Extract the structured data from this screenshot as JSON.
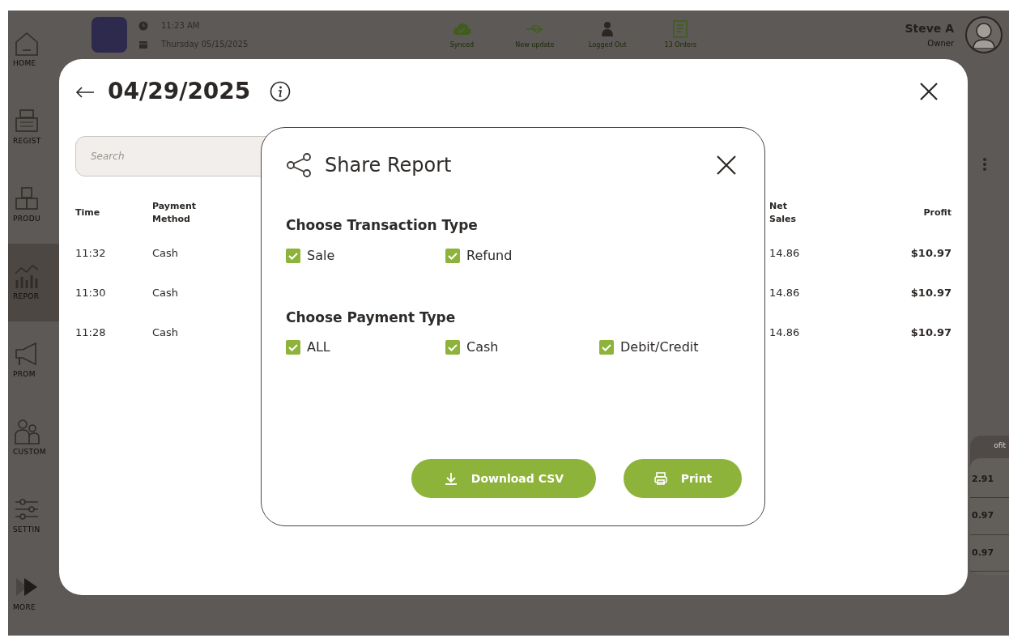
{
  "sidebar": {
    "items": [
      {
        "kind": "home",
        "label": "HOME",
        "selected": false
      },
      {
        "kind": "register",
        "label": "REGIST",
        "selected": false
      },
      {
        "kind": "products",
        "label": "PRODU",
        "selected": false
      },
      {
        "kind": "reports",
        "label": "REPOR",
        "selected": true
      },
      {
        "kind": "promotions",
        "label": "PROM",
        "selected": false
      },
      {
        "kind": "customers",
        "label": "CUSTOM",
        "selected": false
      },
      {
        "kind": "settings",
        "label": "SETTIN",
        "selected": false
      },
      {
        "kind": "more",
        "label": "MORE",
        "selected": false
      }
    ]
  },
  "top_bar": {
    "time": "11:23 AM",
    "date": "Thursday 05/15/2025",
    "status": [
      {
        "kind": "cloud",
        "label": "Synced"
      },
      {
        "kind": "usb",
        "label": "New update"
      },
      {
        "kind": "person",
        "label": "Logged Out"
      },
      {
        "kind": "receipt",
        "label": "13 Orders"
      }
    ],
    "user": {
      "name": "Steve A",
      "role": "Owner"
    }
  },
  "right_panel": {
    "header": "ofit",
    "values": [
      "2.91",
      "0.97",
      "0.97"
    ]
  },
  "report": {
    "date": "04/29/2025",
    "search": {
      "placeholder": "Search"
    },
    "table": {
      "columns": [
        "Time",
        "Payment Method",
        "Net Sales",
        "Profit"
      ],
      "rows": [
        [
          "11:32",
          "Cash",
          "14.86",
          "$10.97"
        ],
        [
          "11:30",
          "Cash",
          "14.86",
          "$10.97"
        ],
        [
          "11:28",
          "Cash",
          "14.86",
          "$10.97"
        ]
      ]
    }
  },
  "share_dialog": {
    "title": "Share Report",
    "transaction_type": {
      "heading": "Choose Transaction Type",
      "options": [
        {
          "label": "Sale",
          "checked": true
        },
        {
          "label": "Refund",
          "checked": true
        }
      ]
    },
    "payment_type": {
      "heading": "Choose Payment Type",
      "options": [
        {
          "label": "ALL",
          "checked": true
        },
        {
          "label": "Cash",
          "checked": true
        },
        {
          "label": "Debit/Credit",
          "checked": true
        }
      ]
    },
    "buttons": [
      {
        "kind": "download",
        "label": "Download CSV"
      },
      {
        "kind": "print",
        "label": "Print"
      }
    ]
  }
}
